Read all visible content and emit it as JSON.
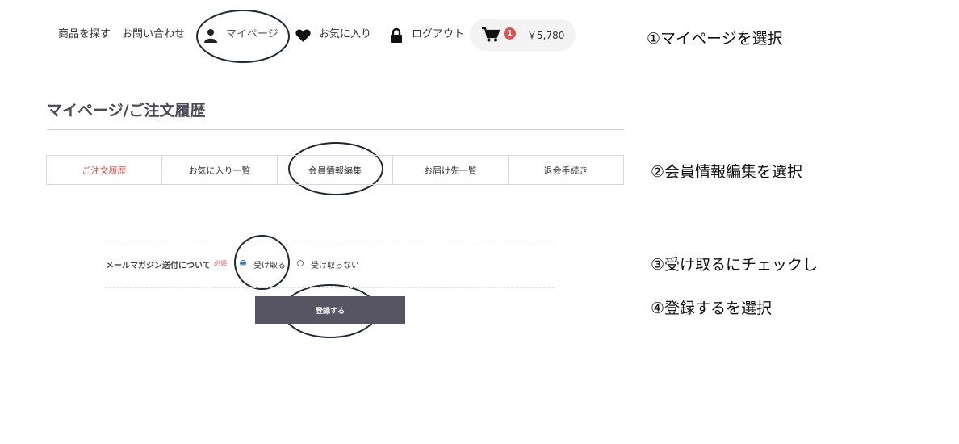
{
  "header": {
    "nav": {
      "search_products": "商品を探す",
      "contact": "お問い合わせ",
      "mypage": "マイページ",
      "favorites": "お気に入り",
      "logout": "ログアウト"
    },
    "cart": {
      "count": "1",
      "total": "￥5,780"
    },
    "icons": [
      "user-icon",
      "heart-icon",
      "lock-icon",
      "cart-icon"
    ]
  },
  "page_title": "マイページ/ご注文履歴",
  "tabs": [
    {
      "label": "ご注文履歴",
      "active": true
    },
    {
      "label": "お気に入り一覧",
      "active": false
    },
    {
      "label": "会員情報編集",
      "active": false
    },
    {
      "label": "お届け先一覧",
      "active": false
    },
    {
      "label": "退会手続き",
      "active": false
    }
  ],
  "form": {
    "newsletter_label": "メールマガジン送付について",
    "required_badge": "必須",
    "option_receive": "受け取る",
    "option_not_receive": "受け取らない",
    "selected": "受け取る",
    "submit_label": "登録する"
  },
  "steps": [
    "①マイページを選択",
    "②会員情報編集を選択",
    "③受け取るにチェックし",
    "④登録するを選択"
  ],
  "colors": {
    "accent_red": "#d9534f",
    "button_bg": "#575563",
    "annotation_ellipse": "#1c2a33",
    "radio_blue": "#2f6fd6"
  }
}
